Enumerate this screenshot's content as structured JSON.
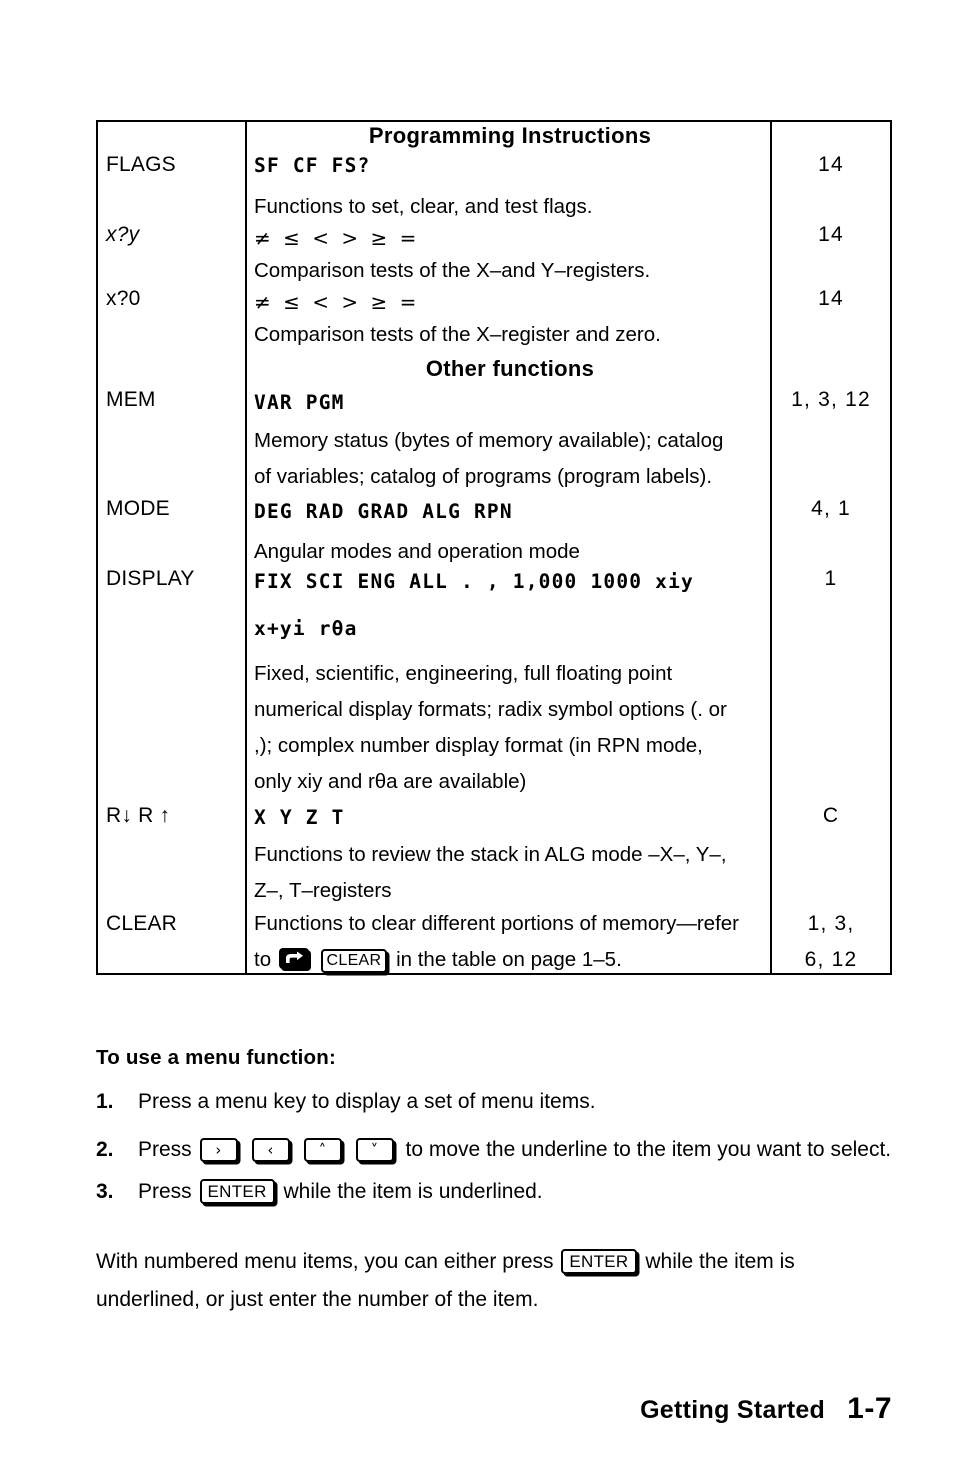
{
  "table": {
    "headers": {
      "programming_instructions": "Programming Instructions",
      "other_functions": "Other functions"
    },
    "rows": [
      {
        "name": "FLAGS",
        "lcd": "SF CF FS?",
        "description": "Functions to set, clear, and test flags.",
        "page": "14"
      },
      {
        "name": "x?y",
        "lcd": "≠ ≤ < > ≥ =",
        "description": "Comparison tests of the X–and Y–registers.",
        "page": "14"
      },
      {
        "name": "x?0",
        "lcd": "≠ ≤ < > ≥ =",
        "description": "Comparison tests of the X–register and zero.",
        "page": "14"
      },
      {
        "name": "MEM",
        "lcd": "VAR PGM",
        "description_line1": "Memory status (bytes of memory available); catalog",
        "description_line2": "of variables; catalog of programs (program labels).",
        "page": "1, 3, 12"
      },
      {
        "name": "MODE",
        "lcd": "DEG RAD GRAD ALG RPN",
        "description": "Angular modes and operation mode",
        "page": "4, 1"
      },
      {
        "name": "DISPLAY",
        "lcd_line1": "FIX SCI ENG ALL . , 1,000 1000 xіy",
        "lcd_line2": "x+yі rθa",
        "description_line1": "Fixed, scientific, engineering, full floating point",
        "description_line2": "numerical display formats; radix symbol options (. or",
        "description_line3": ",); complex number display format (in RPN mode,",
        "description_line4": "only xiy and rθa are available)",
        "page": "1"
      },
      {
        "name": "R↓ R ↑",
        "lcd": "X Y Z T",
        "description_line1": "Functions to review the stack in ALG mode –X–, Y–,",
        "description_line2": "Z–, T–registers",
        "page": "C"
      },
      {
        "name": "CLEAR",
        "description_line1": "Functions to clear different portions of memory—refer",
        "description_line2_pre": "to",
        "description_line2_key": "CLEAR",
        "description_line2_post": "in the table on page 1–5.",
        "page_line1": "1, 3,",
        "page_line2": "6, 12"
      }
    ]
  },
  "instructions": {
    "title": "To use a menu function:",
    "steps": [
      {
        "num": "1.",
        "text": "Press a menu key to display a set of menu items."
      },
      {
        "num": "2.",
        "pre": "Press",
        "keys": [
          "›",
          "‹",
          "˄",
          "˅"
        ],
        "post": "to move the underline to the item you want to select."
      },
      {
        "num": "3.",
        "pre": "Press",
        "key": "ENTER",
        "post": "while the item is underlined."
      }
    ],
    "paragraph": {
      "pre": "With numbered menu items, you can either press",
      "key": "ENTER",
      "post": "while the item is",
      "line2": "underlined, or just enter the number of the item."
    }
  },
  "footer": {
    "title": "Getting Started",
    "page": "1-7"
  }
}
